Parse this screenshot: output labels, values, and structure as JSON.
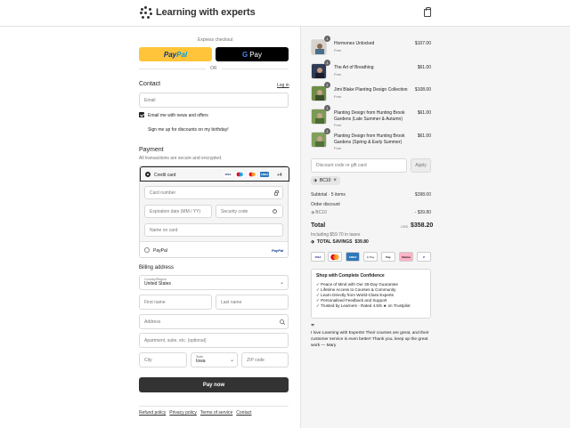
{
  "header": {
    "brand": "Learning with experts",
    "cart_icon": "shopping-bag-icon"
  },
  "express": {
    "label": "Express checkout",
    "paypal_a": "Pay",
    "paypal_b": "Pal",
    "gpay_g": "G",
    "gpay_text": "Pay",
    "or": "OR"
  },
  "contact": {
    "title": "Contact",
    "login": "Log in",
    "email_placeholder": "Email",
    "news_label": "Email me with news and offers",
    "news_checked": true,
    "birthday_label": "Sign me up for discounts on my birthday!",
    "birthday_checked": false
  },
  "payment": {
    "title": "Payment",
    "subtitle": "All transactions are secure and encrypted.",
    "credit_card": "Credit card",
    "card_brands": [
      "VISA",
      "MC",
      "MC",
      "AMEX"
    ],
    "more_brands": "+4",
    "card_number": "Card number",
    "expiration": "Expiration date (MM / YY)",
    "security": "Security code",
    "name_on_card": "Name on card",
    "paypal": "PayPal",
    "paypal_logo": "PayPal"
  },
  "billing": {
    "title": "Billing address",
    "country_label": "Country/Region",
    "country_value": "United States",
    "first_name": "First name",
    "last_name": "Last name",
    "address": "Address",
    "apartment": "Apartment, suite, etc. (optional)",
    "city": "City",
    "state_label": "State",
    "state_value": "Iowa",
    "zip": "ZIP code"
  },
  "pay_now": "Pay now",
  "footer": [
    "Refund policy",
    "Privacy policy",
    "Terms of service",
    "Contact"
  ],
  "summary": {
    "items": [
      {
        "qty": "1",
        "name": "Hormones Unlocked",
        "sub": "Free",
        "price": "$107.00"
      },
      {
        "qty": "1",
        "name": "The Art of Breathing",
        "sub": "Free",
        "price": "$61.00"
      },
      {
        "qty": "1",
        "name": "Jimi Blake Planting Design Collection",
        "sub": "Free",
        "price": "$108.00"
      },
      {
        "qty": "1",
        "name": "Planting Design from Hunting Brook Gardens (Late Summer & Autumn)",
        "sub": "Free",
        "price": "$61.00"
      },
      {
        "qty": "1",
        "name": "Planting Design from Hunting Brook Gardens (Spring & Early Summer)",
        "sub": "Free",
        "price": "$61.00"
      }
    ],
    "discount_placeholder": "Discount code or gift card",
    "apply": "Apply",
    "code_tag": "BC10",
    "subtotal_label": "Subtotal · 5 items",
    "subtotal_value": "$398.00",
    "order_discount_label": "Order discount",
    "code_label": "BC10",
    "discount_value": "- $39.80",
    "total_label": "Total",
    "currency": "USD",
    "total_value": "$358.20",
    "taxes": "Including $59.70 in taxes",
    "savings_label": "TOTAL SAVINGS",
    "savings_value": "$39.80",
    "payment_marks": [
      "VISA",
      "MC",
      "AMEX",
      "G Pay",
      "Pay",
      "Klarna",
      "P"
    ],
    "confidence_title": "Shop with Complete Confidence",
    "confidence_items": [
      "✓ Peace of Mind with Our 30-Day Guarantee",
      "✓ Lifetime Access to Courses & Community",
      "✓ Learn Directly from World-Class Experts",
      "✓ Personalised Feedback and Support",
      "✓ Trusted by Learners - Rated 4.5/5 ★ on Trustpilot"
    ],
    "quote_mark": "”",
    "testimonial": "I love Learning with Experts! Their courses are great, and their customer service is even better! Thank you, keep up the great work — Mary"
  }
}
